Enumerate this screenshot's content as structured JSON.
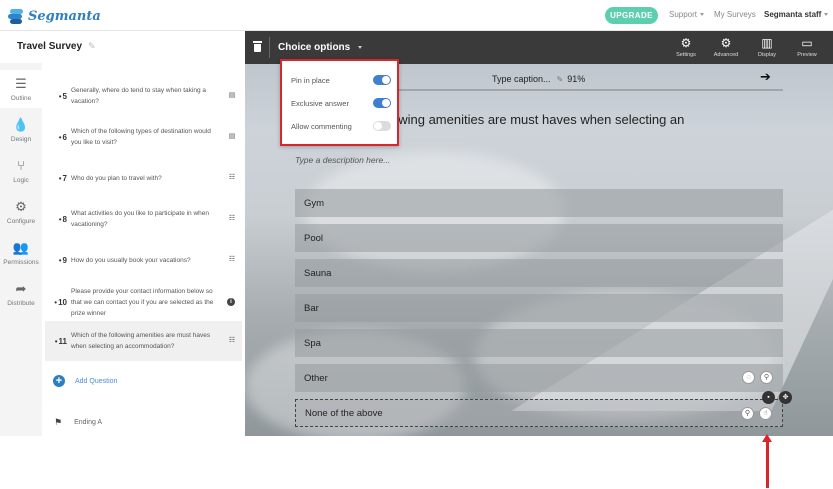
{
  "app": {
    "brand": "Segmanta",
    "upgrade_label": "UPGRADE",
    "support_label": "Support",
    "my_surveys_label": "My Surveys",
    "account_label": "Segmanta staff"
  },
  "survey": {
    "title": "Travel Survey"
  },
  "rail": [
    {
      "label": "Outline",
      "icon": "list-icon"
    },
    {
      "label": "Design",
      "icon": "drop-icon"
    },
    {
      "label": "Logic",
      "icon": "branch-icon"
    },
    {
      "label": "Configure",
      "icon": "gear-icon"
    },
    {
      "label": "Permissions",
      "icon": "people-icon"
    },
    {
      "label": "Distribute",
      "icon": "share-icon"
    }
  ],
  "outline": {
    "questions": [
      {
        "num": "5",
        "text": "Generally, where do tend to stay when taking a vacation?",
        "type": "text-icon"
      },
      {
        "num": "6",
        "text": "Which of the following types of destination would you like to visit?",
        "type": "text-icon"
      },
      {
        "num": "7",
        "text": "Who do you plan to travel with?",
        "type": "list-icon"
      },
      {
        "num": "8",
        "text": "What activities do you like to participate in when vacationing?",
        "type": "list-icon"
      },
      {
        "num": "9",
        "text": "How do you usually book your vacations?",
        "type": "list-icon"
      },
      {
        "num": "10",
        "text": "Please provide your contact information below so that we can contact you if you are selected as the prize winner",
        "type": "info-icon"
      },
      {
        "num": "11",
        "text": "Which of the following amenities are must haves when selecting an accommodation?",
        "type": "list-icon"
      }
    ],
    "add_question_label": "Add Question",
    "ending_label": "Ending A"
  },
  "toolbar": {
    "choice_options_label": "Choice options",
    "buttons": [
      {
        "label": "Settings",
        "icon": "gear-icon"
      },
      {
        "label": "Advanced",
        "icon": "gears-icon"
      },
      {
        "label": "Display",
        "icon": "book-icon"
      },
      {
        "label": "Preview",
        "icon": "monitor-icon"
      }
    ]
  },
  "editor": {
    "caption_placeholder": "Type caption...",
    "progress": "91%",
    "question_title": "owing amenities are must haves when selecting an",
    "description_placeholder": "Type a description here...",
    "choices": [
      "Gym",
      "Pool",
      "Sauna",
      "Bar",
      "Spa",
      "Other",
      "None of the above"
    ]
  },
  "popover": {
    "options": [
      {
        "label": "Pin in place",
        "on": true
      },
      {
        "label": "Exclusive answer",
        "on": true
      },
      {
        "label": "Allow commenting",
        "on": false
      }
    ]
  },
  "colors": {
    "brand": "#2d7fc1",
    "upgrade": "#5dcfb0",
    "toolbar": "#3a3a3a",
    "toggle_on": "#3f7fd1",
    "annotation": "#d9262a"
  }
}
